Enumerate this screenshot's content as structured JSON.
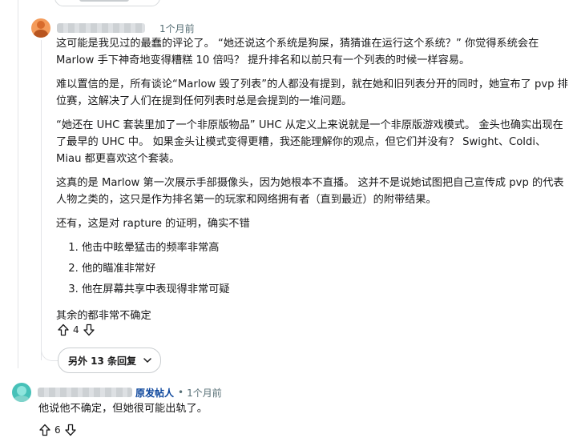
{
  "comment1": {
    "time": "1个月前",
    "paragraphs": [
      "这可能是我见过的最蠢的评论了。 “她还说这个系统是狗屎，猜猜谁在运行这个系统？” 你觉得系统会在 Marlow 手下神奇地变得糟糕 10 倍吗？ 提升排名和以前只有一个列表的时候一样容易。",
      "难以置信的是，所有谈论“Marlow 毁了列表”的人都没有提到，就在她和旧列表分开的同时，她宣布了 pvp 排位赛，这解决了人们在提到任何列表时总是会提到的一堆问题。",
      "“她还在 UHC 套装里加了一个非原版物品” UHC 从定义上来说就是一个非原版游戏模式。 金头也确实出现在了最早的 UHC 中。 如果金头让模式变得更糟，我还能理解你的观点，但它们并没有？ Swight、Coldi、Miau 都更喜欢这个套装。",
      "这真的是 Marlow 第一次展示手部摄像头，因为她根本不直播。 这并不是说她试图把自己宣传成 pvp 的代表人物之类的，这只是作为排名第一的玩家和网络拥有者（直到最近）的附带结果。",
      "还有，这是对 rapture 的证明，确实不错"
    ],
    "list": [
      "他击中眩晕猛击的频率非常高",
      "他的瞄准非常好",
      "他在屏幕共享中表现得非常可疑"
    ],
    "closing": "其余的都非常不确定",
    "votes": "4"
  },
  "more_replies": {
    "label": "另外 13 条回复"
  },
  "comment2": {
    "op_label": "原发帖人",
    "separator": "•",
    "time": "1个月前",
    "text": "他说他不确定，但她很可能出轨了。",
    "votes": "6"
  },
  "colors": {
    "text": "#1a1a1b",
    "meta": "#576f76",
    "op_blue": "#0a449b",
    "thread_line": "#e3e5e8"
  },
  "icons": [
    "upvote-icon",
    "downvote-icon",
    "chevron-down-icon"
  ]
}
